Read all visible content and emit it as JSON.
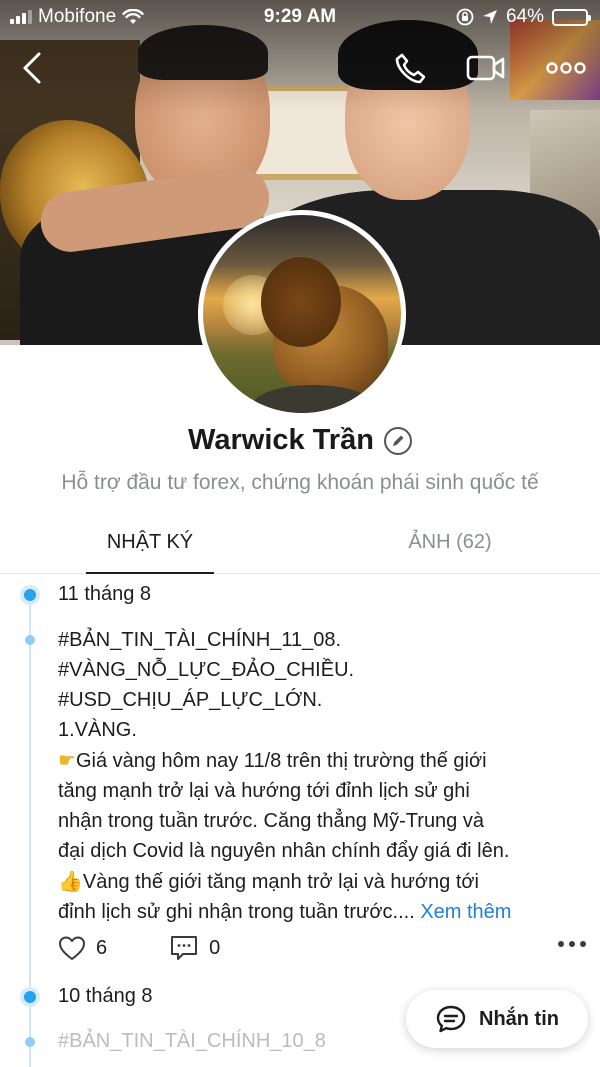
{
  "status_bar": {
    "carrier": "Mobifone",
    "time": "9:29 AM",
    "battery": "64%",
    "battery_level": 0.64
  },
  "nav": {
    "icons": [
      "back-chevron-icon",
      "phone-icon",
      "video-call-icon",
      "more-options-icon"
    ]
  },
  "profile": {
    "name": "Warwick Trần",
    "bio": "Hỗ trợ đầu tư forex, chứng khoán phái sinh quốc tế"
  },
  "tabs": [
    {
      "label": "NHẬT KÝ",
      "active": true
    },
    {
      "label": "ẢNH (62)",
      "active": false
    }
  ],
  "timeline": {
    "posts": [
      {
        "date": "11 tháng 8",
        "lines": [
          "#BẢN_TIN_TÀI_CHÍNH_11_08.",
          "#VÀNG_NỖ_LỰC_ĐẢO_CHIỀU.",
          "#USD_CHỊU_ÁP_LỰC_LỚN.",
          "1.VÀNG."
        ],
        "paragraph1_lines": [
          "Giá vàng hôm nay 11/8 trên thị trường thế giới",
          "tăng mạnh trở lại và hướng tới đỉnh lịch sử ghi",
          "nhận trong tuần trước. Căng thẳng Mỹ-Trung và",
          "đại dịch Covid là nguyên nhân chính đẩy giá đi lên."
        ],
        "paragraph2_lines": [
          "Vàng thế giới tăng mạnh trở lại và hướng tới",
          "đỉnh lịch sử ghi nhận trong tuần trước...."
        ],
        "see_more": "Xem thêm",
        "likes": "6",
        "comments": "0"
      },
      {
        "date": "10 tháng 8",
        "preview": "#BẢN_TIN_TÀI_CHÍNH_10_8"
      }
    ]
  },
  "fab": {
    "label": "Nhắn tin"
  },
  "colors": {
    "accent": "#27a2ef",
    "link": "#1f7fe0",
    "muted": "#8a8e94",
    "text": "#1d1d1f"
  }
}
